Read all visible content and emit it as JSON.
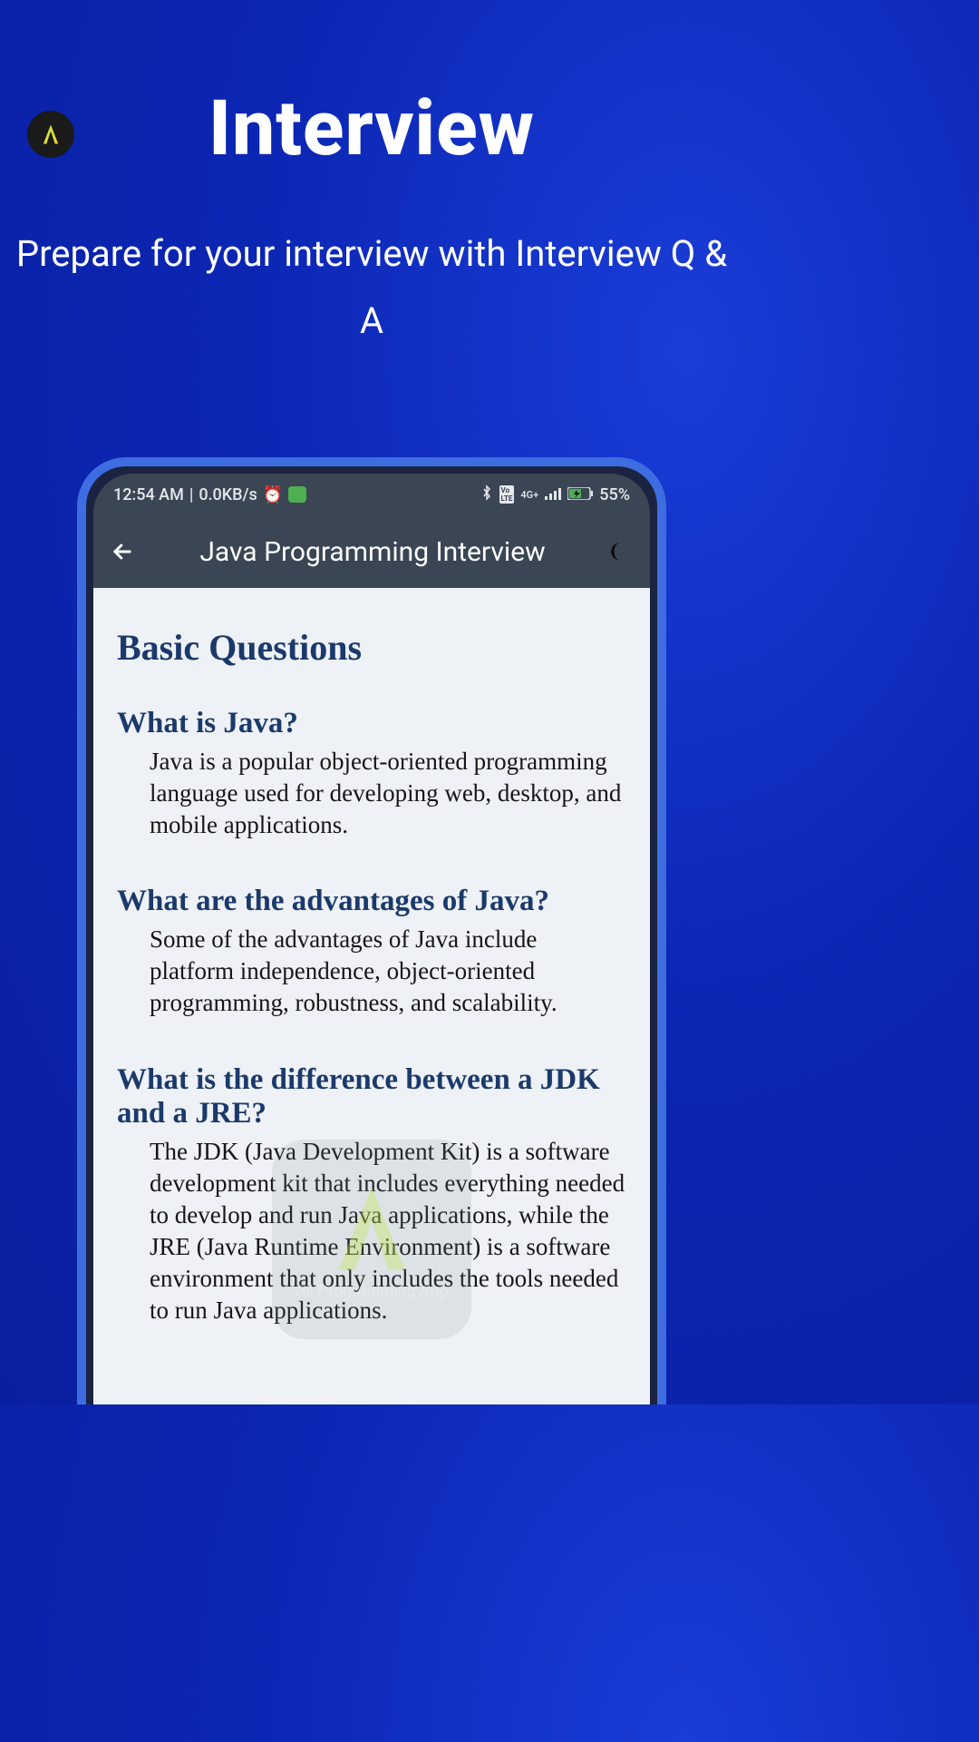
{
  "promo": {
    "title": "Interview",
    "subtitle": "Prepare for your interview with Interview Q & A"
  },
  "statusBar": {
    "time": "12:54 AM",
    "dataRate": "0.0KB/s",
    "networkLabel": "4G+",
    "battery": "55%"
  },
  "appBar": {
    "title": "Java Programming Interview"
  },
  "content": {
    "sectionTitle": "Basic Questions",
    "qa": [
      {
        "question": "What is Java?",
        "answer": "Java is a popular object-oriented programming language used for developing web, desktop, and mobile applications."
      },
      {
        "question": "What are the advantages of Java?",
        "answer": "Some of the advantages of Java include platform independence, object-oriented programming, robustness, and scalability."
      },
      {
        "question": "What is the difference between a JDK and a JRE?",
        "answer": "The JDK (Java Development Kit) is a software development kit that includes everything needed to develop and run Java applications, while the JRE (Java Runtime Environment) is a software environment that only includes the tools needed to run Java applications."
      }
    ]
  },
  "watermark": {
    "label": "All Programming App"
  }
}
